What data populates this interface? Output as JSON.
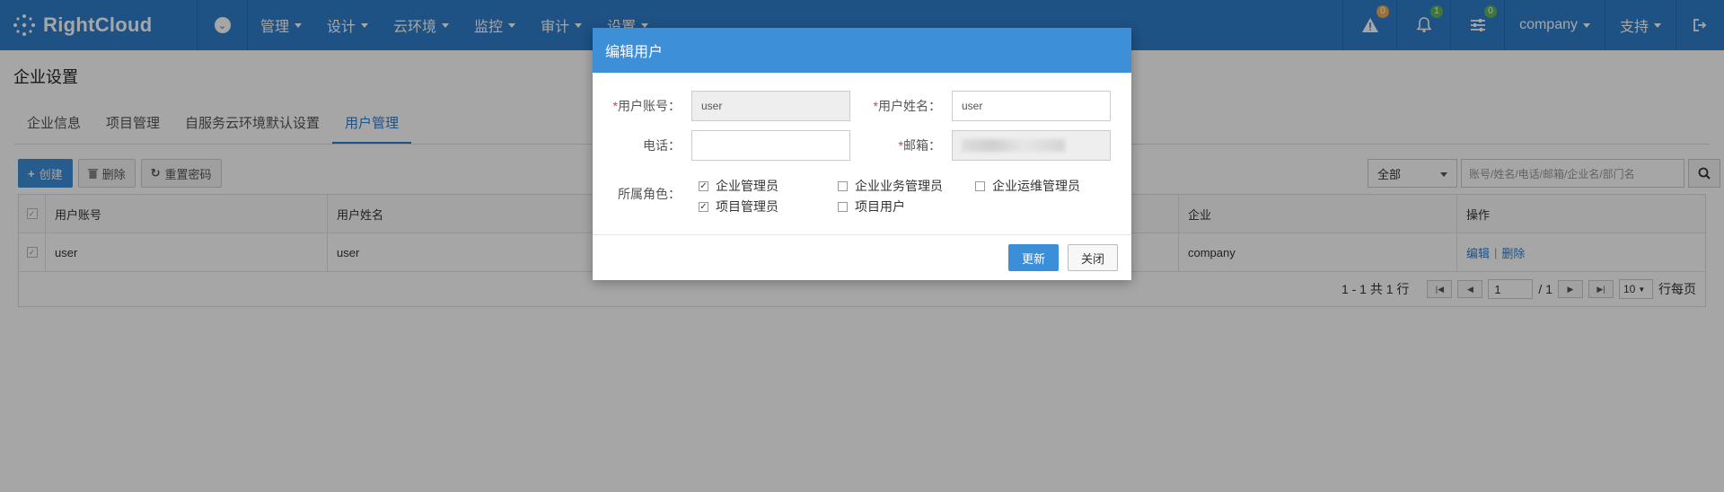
{
  "brand": {
    "name": "RightCloud"
  },
  "nav": {
    "menu": [
      {
        "label": "管理"
      },
      {
        "label": "设计"
      },
      {
        "label": "云环境"
      },
      {
        "label": "监控"
      },
      {
        "label": "审计"
      },
      {
        "label": "设置"
      }
    ],
    "alerts_badge": "0",
    "notifications_badge": "1",
    "tasks_badge": "0",
    "company": "company",
    "support": "支持"
  },
  "page": {
    "title": "企业设置",
    "tabs": [
      {
        "label": "企业信息"
      },
      {
        "label": "项目管理"
      },
      {
        "label": "自服务云环境默认设置"
      },
      {
        "label": "用户管理"
      }
    ],
    "active_tab": "用户管理"
  },
  "toolbar": {
    "create": "创建",
    "delete": "删除",
    "reset_password": "重置密码"
  },
  "filter": {
    "selected": "全部",
    "search_placeholder": "账号/姓名/电话/邮箱/企业名/部门名"
  },
  "table": {
    "headers": {
      "account": "用户账号",
      "name": "用户姓名",
      "company": "企业",
      "actions": "操作"
    },
    "rows": [
      {
        "account": "user",
        "name": "user",
        "company": "company",
        "edit": "编辑",
        "sep": "|",
        "delete": "删除"
      }
    ]
  },
  "pager": {
    "summary": "1 - 1 共 1 行",
    "page": "1",
    "total": "/ 1",
    "page_size": "10",
    "per_page_label": "行每页"
  },
  "modal": {
    "title": "编辑用户",
    "account_label": "用户账号：",
    "account_value": "user",
    "name_label": "用户姓名：",
    "name_value": "user",
    "phone_label": "电话：",
    "email_label": "邮箱：",
    "roles_label": "所属角色：",
    "roles": [
      {
        "label": "企业管理员",
        "checked": true
      },
      {
        "label": "企业业务管理员",
        "checked": false
      },
      {
        "label": "企业运维管理员",
        "checked": false
      },
      {
        "label": "项目管理员",
        "checked": true
      },
      {
        "label": "项目用户",
        "checked": false
      }
    ],
    "update_button": "更新",
    "close_button": "关闭"
  },
  "colors": {
    "primary": "#2f7fcd",
    "modal_header": "#3d8fd7",
    "required": "#e23a3a",
    "badge_warning": "#f0ad4e",
    "badge_success": "#5cb85c"
  }
}
